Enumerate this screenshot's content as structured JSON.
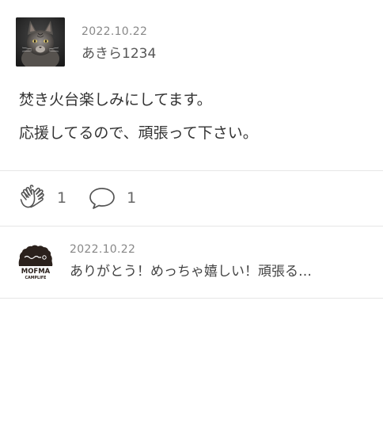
{
  "post": {
    "date": "2022.10.22",
    "username": "あきら1234",
    "lines": [
      "焚き火台楽しみにしてます。",
      "応援してるので、頑張って下さい。"
    ],
    "clap_count": "1",
    "comment_count": "1",
    "avatar_icon": "cat-photo"
  },
  "reply": {
    "date": "2022.10.22",
    "text": "ありがとう！めっちゃ嬉しい！頑張る…",
    "avatar_icon": "mofma-logo",
    "logo_line1": "MOFMA",
    "logo_line2": "CAMPLIFE"
  },
  "icons": {
    "clap": "clap-icon",
    "comment": "speech-bubble-icon"
  }
}
